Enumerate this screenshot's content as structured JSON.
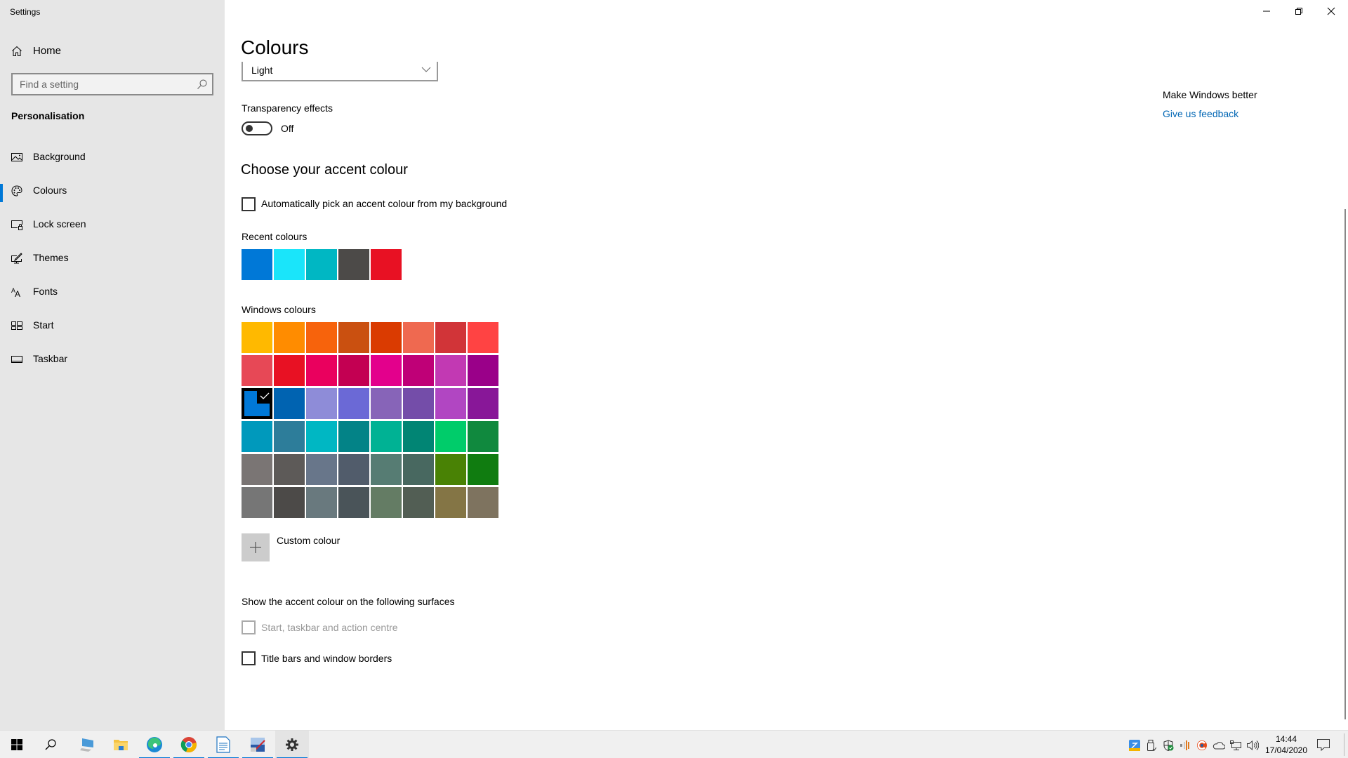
{
  "window": {
    "title": "Settings",
    "controls": {
      "minimize": "minimize",
      "restore": "restore",
      "close": "close"
    }
  },
  "sidebar": {
    "home_label": "Home",
    "search_placeholder": "Find a setting",
    "section_title": "Personalisation",
    "items": [
      {
        "label": "Background",
        "icon": "image-icon",
        "active": false
      },
      {
        "label": "Colours",
        "icon": "palette-icon",
        "active": true
      },
      {
        "label": "Lock screen",
        "icon": "lock-screen-icon",
        "active": false
      },
      {
        "label": "Themes",
        "icon": "themes-icon",
        "active": false
      },
      {
        "label": "Fonts",
        "icon": "fonts-icon",
        "active": false
      },
      {
        "label": "Start",
        "icon": "start-icon",
        "active": false
      },
      {
        "label": "Taskbar",
        "icon": "taskbar-icon",
        "active": false
      }
    ],
    "accent": "#0078d7"
  },
  "main": {
    "title": "Colours",
    "mode_dropdown": {
      "value": "Light"
    },
    "transparency": {
      "label": "Transparency effects",
      "state": "Off",
      "on": false
    },
    "accent_heading": "Choose your accent colour",
    "auto_pick": {
      "label": "Automatically pick an accent colour from my background",
      "checked": false
    },
    "recent_label": "Recent colours",
    "recent_colours": [
      "#0078d7",
      "#1ae5fa",
      "#00b7c3",
      "#4c4a48",
      "#e81123"
    ],
    "windows_label": "Windows colours",
    "windows_colours": [
      [
        "#ffb900",
        "#ff8c00",
        "#f7630c",
        "#ca5010",
        "#da3b01",
        "#ef6950",
        "#d13438",
        "#ff4343"
      ],
      [
        "#e74856",
        "#e81123",
        "#ea005e",
        "#c30052",
        "#e3008c",
        "#bf0077",
        "#c239b3",
        "#9a0089"
      ],
      [
        "#0078d7",
        "#0063b1",
        "#8e8cd8",
        "#6b69d6",
        "#8764b8",
        "#744da9",
        "#b146c2",
        "#881798"
      ],
      [
        "#0099bc",
        "#2d7d9a",
        "#00b7c3",
        "#038387",
        "#00b294",
        "#018574",
        "#00cc6a",
        "#10893e"
      ],
      [
        "#7a7574",
        "#5d5a58",
        "#68768a",
        "#515c6b",
        "#567c73",
        "#486860",
        "#498205",
        "#107c10"
      ],
      [
        "#767676",
        "#4c4a48",
        "#69797e",
        "#4a5459",
        "#647c64",
        "#525e54",
        "#847545",
        "#7e735f"
      ]
    ],
    "selected_colour": {
      "row": 2,
      "col": 0
    },
    "custom_colour_label": "Custom colour",
    "surfaces_heading": "Show the accent colour on the following surfaces",
    "surfaces": [
      {
        "label": "Start, taskbar and action centre",
        "checked": false,
        "disabled": true
      },
      {
        "label": "Title bars and window borders",
        "checked": false,
        "disabled": false
      }
    ]
  },
  "feedback": {
    "title": "Make Windows better",
    "link": "Give us feedback"
  },
  "taskbar": {
    "apps": [
      {
        "name": "start-button",
        "running": false
      },
      {
        "name": "search-button",
        "running": false
      },
      {
        "name": "this-pc",
        "running": false
      },
      {
        "name": "file-explorer",
        "running": false
      },
      {
        "name": "edge",
        "running": true
      },
      {
        "name": "chrome",
        "running": true
      },
      {
        "name": "writer",
        "running": true
      },
      {
        "name": "paint-app",
        "running": true
      },
      {
        "name": "settings",
        "running": true,
        "active": true
      }
    ],
    "tray_icons": [
      "app-tray-icon",
      "usb-icon",
      "defender-icon",
      "audio-app-icon",
      "ccleaner-icon",
      "onedrive-icon",
      "network-icon",
      "volume-icon"
    ],
    "time": "14:44",
    "date": "17/04/2020"
  }
}
